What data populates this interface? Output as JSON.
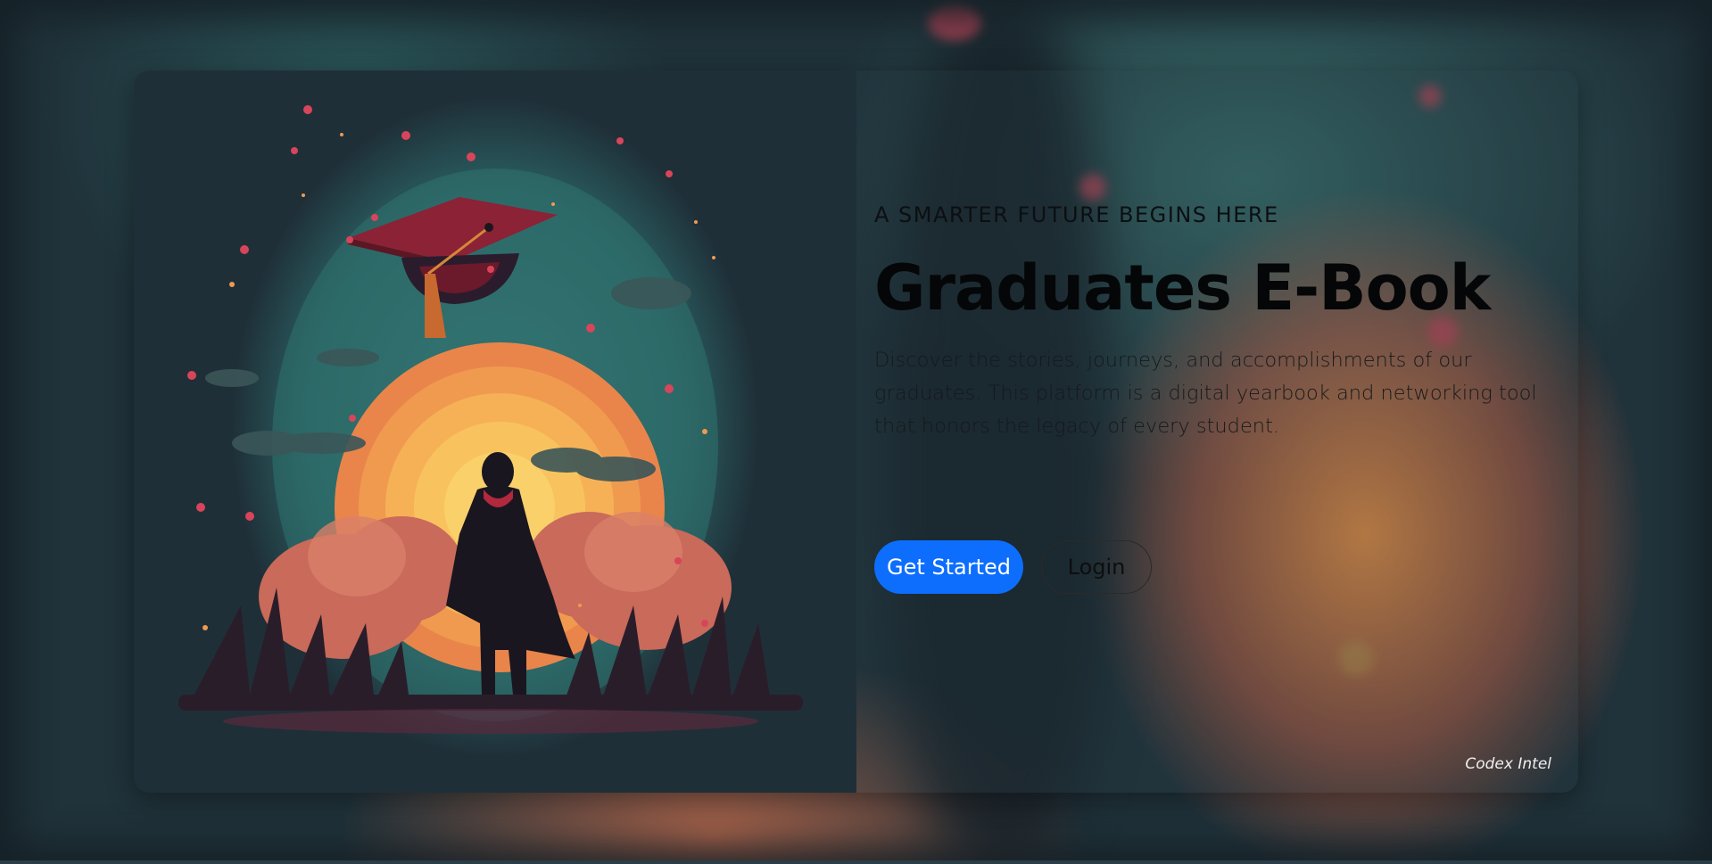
{
  "hero": {
    "tagline": "A SMARTER FUTURE BEGINS HERE",
    "title": "Graduates E-Book",
    "description": "Discover the stories, journeys, and accomplishments of our graduates. This platform is a digital yearbook and networking tool that honors the legacy of every student.",
    "primary_button": "Get Started",
    "secondary_button": "Login"
  },
  "brand": "Codex Intel",
  "illustration": {
    "subject": "graduate-with-cap-illustration"
  },
  "colors": {
    "primary": "#0d6efd",
    "card_bg": "#1f2f38",
    "sun": "#f4a552",
    "cap": "#7c1f2e"
  }
}
